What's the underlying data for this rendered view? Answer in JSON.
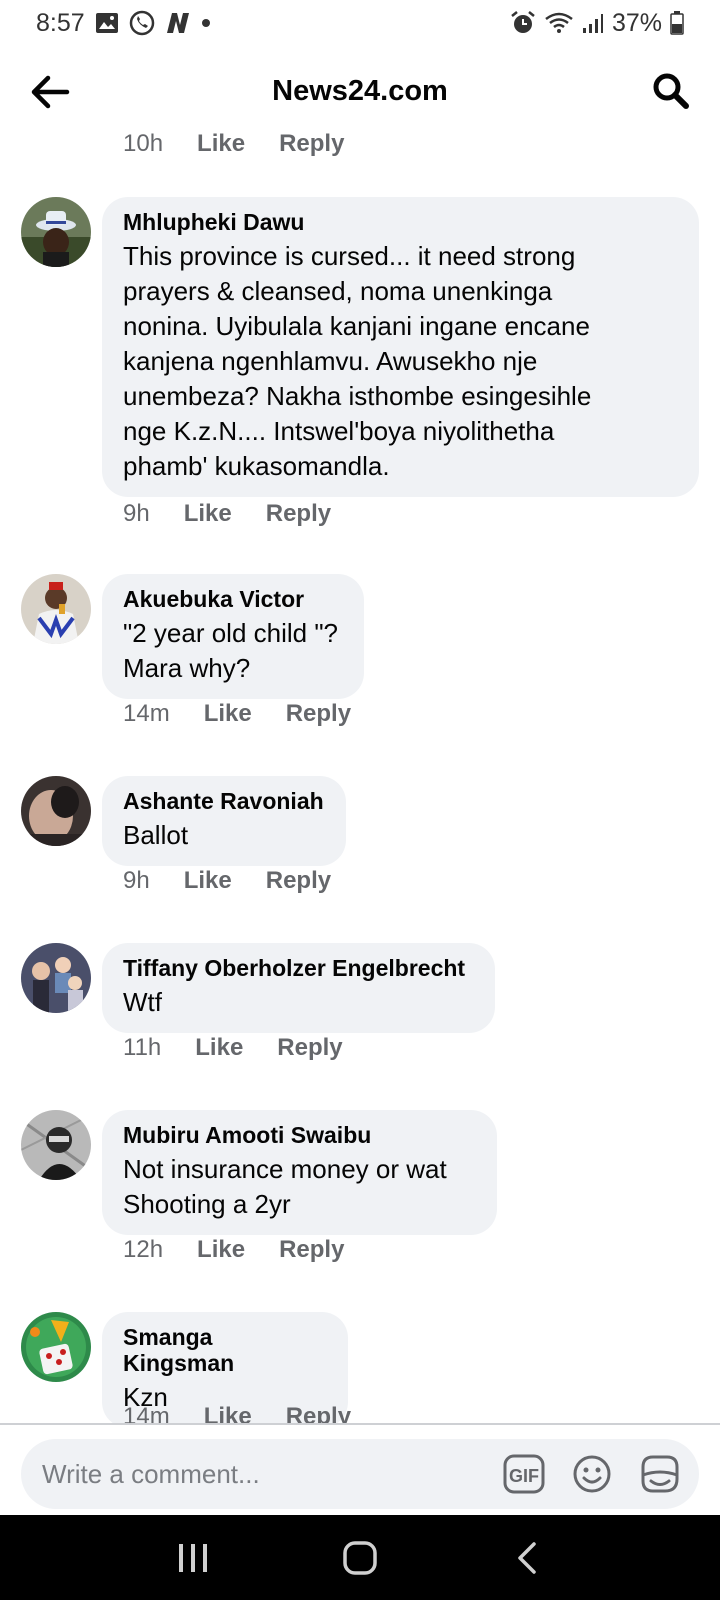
{
  "status": {
    "time": "8:57",
    "battery": "37%"
  },
  "header": {
    "title": "News24.com"
  },
  "top_actions": {
    "time": "10h",
    "like": "Like",
    "reply": "Reply"
  },
  "comments": [
    {
      "author": "Mhlupheki Dawu",
      "text": "This  province  is  cursed... it  need  strong\nprayers  & cleansed,  noma   unenkinga\nnonina.  Uyibulala  kanjani  ingane  encane\nkanjena   ngenhlamvu.  Awusekho  nje\nunembeza?  Nakha  isthombe  esingesihle\nnge  K.z.N.... Intswel'boya  niyolithetha\nphamb'   kukasomandla.",
      "time": "9h",
      "like": "Like",
      "reply": "Reply"
    },
    {
      "author": "Akuebuka Victor",
      "text": "\"2 year old child \"?\nMara why?",
      "time": "14m",
      "like": "Like",
      "reply": "Reply"
    },
    {
      "author": "Ashante Ravoniah",
      "text": "Ballot",
      "time": "9h",
      "like": "Like",
      "reply": "Reply"
    },
    {
      "author": "Tiffany Oberholzer Engelbrecht",
      "text": "Wtf",
      "time": "11h",
      "like": "Like",
      "reply": "Reply"
    },
    {
      "author": "Mubiru Amooti Swaibu",
      "text": "Not insurance money or wat\nShooting a 2yr",
      "time": "12h",
      "like": "Like",
      "reply": "Reply"
    },
    {
      "author": "Smanga Kingsman",
      "text": "Kzn",
      "time": "14m",
      "like": "Like",
      "reply": "Reply"
    }
  ],
  "composer": {
    "placeholder": "Write a comment...",
    "gif_label": "GIF"
  },
  "colors": {
    "bubble": "#f0f2f5",
    "meta": "#65676b",
    "text": "#050505"
  },
  "icons": {
    "status_left": [
      "gallery-icon",
      "whatsapp-icon",
      "app-n-icon",
      "dot-icon"
    ],
    "status_right": [
      "alarm-icon",
      "wifi-icon",
      "signal-icon",
      "battery-icon"
    ],
    "composer": [
      "gif-icon",
      "emoji-icon",
      "sticker-icon"
    ],
    "nav": [
      "recents-icon",
      "home-icon",
      "back-nav-icon"
    ]
  }
}
